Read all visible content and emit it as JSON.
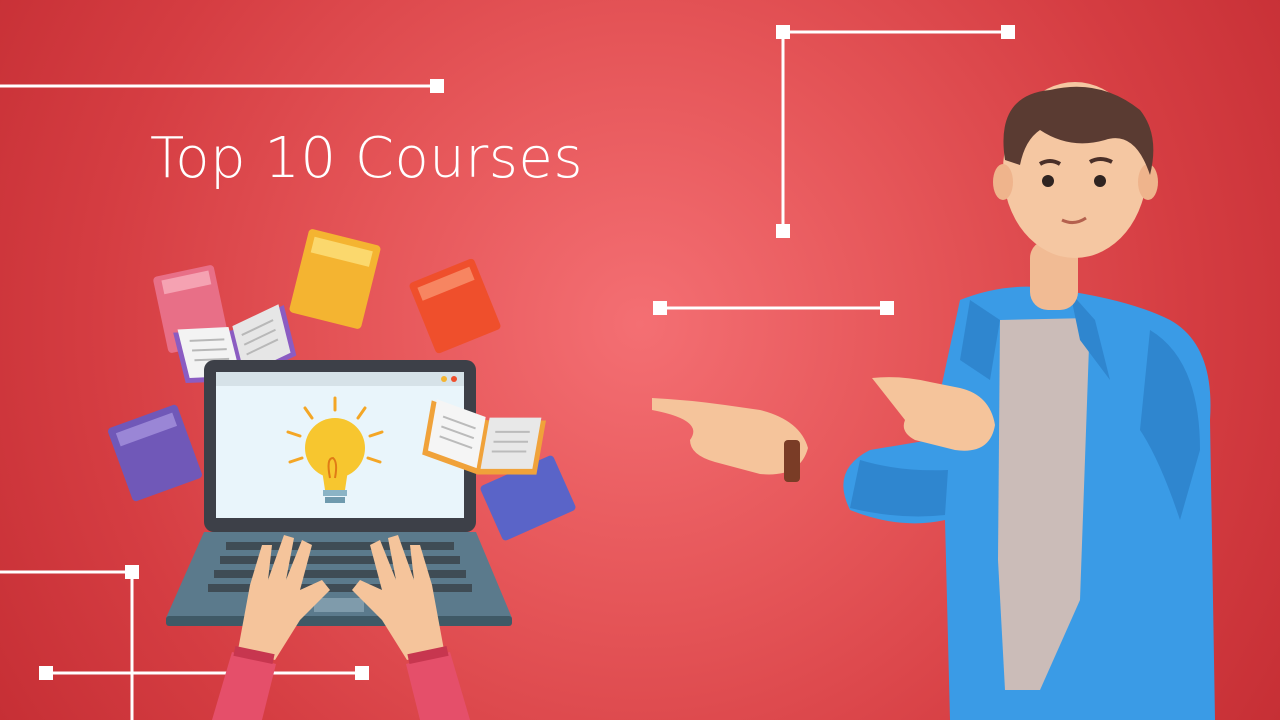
{
  "title": "Top 10 Courses",
  "colors": {
    "background": "#e55558",
    "accent_line": "#ffffff",
    "shirt": "#3a9be6",
    "laptop_body": "#5b7a8c",
    "bulb": "#f7c62f"
  },
  "icons": {
    "illustration_left": "laptop-with-lightbulb-and-flying-books",
    "illustration_right": "3d-man-pointing-left"
  }
}
